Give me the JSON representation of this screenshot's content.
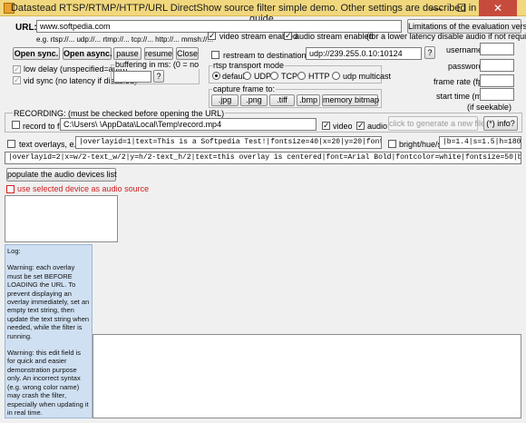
{
  "window": {
    "title": "Datastead RTSP/RTMP/HTTP/URL DirectShow source filter simple demo. Other settings are described in the user guide.",
    "minimize": "—",
    "maximize": "☐",
    "close": "✕"
  },
  "url": {
    "label": "URL:",
    "value": "www.softpedia.com",
    "hint": "e.g. rtsp://... udp://... rtmp://... tcp://... http://...  mmsh://..."
  },
  "buttons": {
    "limitations": "Limitations of the evaluation version?",
    "open_sync": "Open sync.",
    "open_async": "Open async.",
    "pause": "pause",
    "resume": "resume",
    "close": "Close",
    "buffer_q": "?",
    "restream_q": "?",
    "jpg": ".jpg",
    "png": ".png",
    "tiff": ".tiff",
    "bmp": ".bmp",
    "memory_bitmap": "memory bitmap",
    "generate_file": "click to generate a new file (*)",
    "info": "(*) info?",
    "populate_audio": "populate the audio devices list"
  },
  "options": {
    "video_stream": "video stream enabled",
    "audio_stream": "audio stream enabled",
    "audio_hint": "(for a lower latency disable audio if not required)",
    "low_delay": "low delay (unspecified=auto)",
    "vid_sync": "vid sync (no latency if disabled)",
    "restream": "restream to destination URL:",
    "restream_value": "udp://239.255.0.10:10124"
  },
  "buffering": {
    "label": "buffering in ms: (0 = no",
    "value": ""
  },
  "transport": {
    "label": "rtsp transport mode",
    "default": "default",
    "udp": "UDP",
    "tcp": "TCP",
    "http": "HTTP",
    "udp_multicast": "udp multicast"
  },
  "capture": {
    "label": "capture frame to:"
  },
  "auth": {
    "username": "username:",
    "password": "password:",
    "frame_rate": "frame rate (fps):",
    "start_time": "start time (ms):",
    "if_seekable": "(if seekable)"
  },
  "recording": {
    "label": "RECORDING: (must be checked before opening the URL)",
    "record_to": "record to file:",
    "path": "C:\\Users\\          \\AppData\\Local\\Temp\\record.mp4",
    "video": "video",
    "audio": "audio"
  },
  "overlay": {
    "label": "text overlays, e.g.:",
    "line1": "|overlayid=1|text=This is a Softpedia Test!|fontsize=40|x=20|y=20|fontcolor=wh",
    "line2": "|overlayid=2|x=w/2-text_w/2|y=h/2-text_h/2|text=this overlay is centered|font=Arial Bold|fontcolor=white|fontsize=50|borderw=4|bo",
    "bhs_label": "bright/hue/sat:",
    "bhs_value": "|b=1.4|s=1.5|h=180"
  },
  "audio_device": {
    "use_selected": "use selected device as audio source"
  },
  "log": {
    "label": "Log:",
    "para1": "Warning: each overlay must be set BEFORE LOADING the URL. To prevent displaying an overlay immediately, set an empty text string, then update the text string when needed, while the filter is running.",
    "para2": "Warning: this edit field is for quick and easier demonstration purpose only. An incorrect syntax (e.g. wrong color name) may crash the filter, especially when updating it in real time."
  },
  "colors": {
    "titlebar": "#f1d77d",
    "close_button": "#c74b3c",
    "log_panel": "#cfe0f2",
    "disabled_text": "#9a9a9a",
    "warning_red": "#d02020"
  }
}
